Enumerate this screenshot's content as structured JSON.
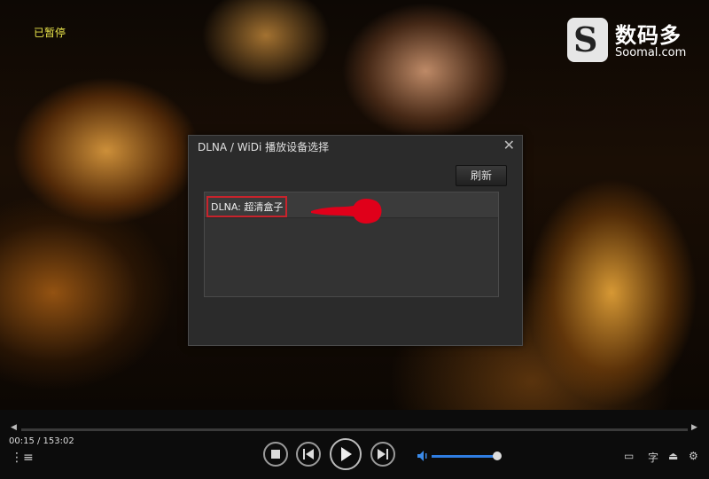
{
  "player": {
    "status": "已暂停",
    "time": "00:15 / 153:02",
    "volume": 0.98
  },
  "watermark": {
    "cn": "数码多",
    "en": "Soomal.com",
    "mark": "S"
  },
  "dialog": {
    "title": "DLNA / WiDi 播放设备选择",
    "refresh_label": "刷新",
    "devices": [
      {
        "label": "DLNA: 超清盒子"
      }
    ]
  },
  "icons": {
    "close": "close-icon",
    "stop": "stop-icon",
    "prev": "previous-icon",
    "play": "play-icon",
    "next": "next-icon",
    "volume": "volume-icon",
    "playlist": "playlist-icon",
    "screen": "screen-icon",
    "subtitle": "subtitle-icon",
    "eject": "eject-icon",
    "settings": "gear-icon"
  },
  "colors": {
    "accent": "#2f7de1",
    "highlight_border": "#c8232c",
    "status_text": "#e8e34a"
  }
}
